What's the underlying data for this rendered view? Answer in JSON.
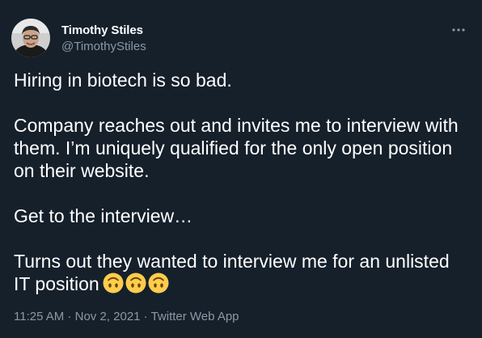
{
  "author": {
    "name": "Timothy Stiles",
    "handle": "@TimothyStiles"
  },
  "tweet": {
    "lines": [
      "Hiring in biotech is so bad.",
      "",
      "Company reaches out and invites me to interview with",
      "them. I’m uniquely qualified for the only open position",
      "on their website.",
      "",
      "Get to the interview…",
      "",
      "Turns out they wanted to interview me for an unlisted",
      "IT position"
    ],
    "emoji_icons": [
      "upside-down-face-icon",
      "upside-down-face-icon",
      "upside-down-face-icon"
    ]
  },
  "meta": {
    "time": "11:25 AM",
    "separator": " · ",
    "date": "Nov 2, 2021",
    "source": "Twitter Web App"
  },
  "colors": {
    "background": "#15202b",
    "text": "#ffffff",
    "muted": "#8b98a5",
    "emoji": "#ffcc4d"
  },
  "icons": {
    "more": "more-options-icon",
    "avatar": "avatar"
  }
}
